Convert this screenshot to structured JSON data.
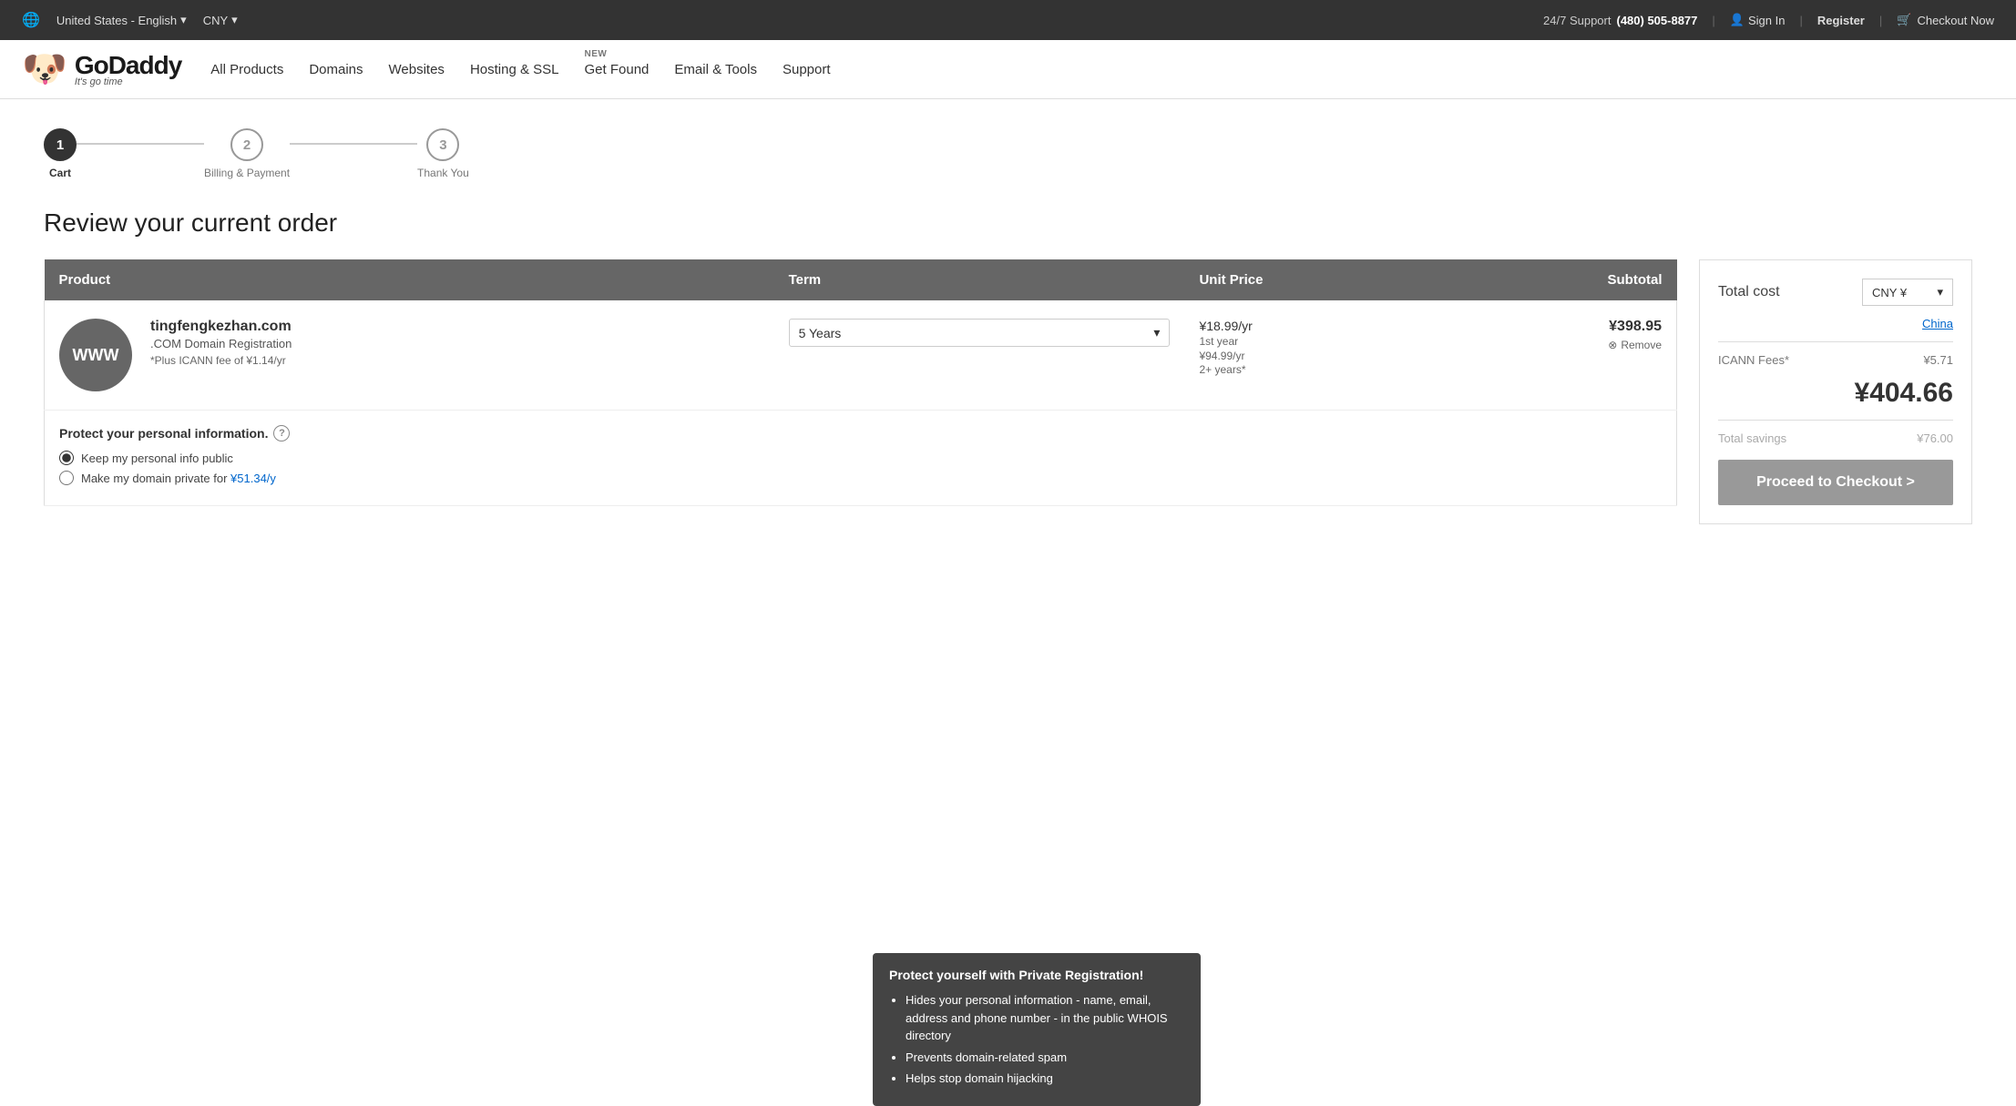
{
  "topbar": {
    "locale_label": "United States - English",
    "locale_arrow": "▾",
    "currency_label": "CNY",
    "currency_arrow": "▾",
    "support_label": "24/7 Support",
    "phone": "(480) 505-8877",
    "sign_in": "Sign In",
    "register": "Register",
    "checkout_now": "Checkout Now",
    "globe_icon": "🌐",
    "user_icon": "👤",
    "cart_icon": "🛒"
  },
  "nav": {
    "all_products": "All Products",
    "domains": "Domains",
    "websites": "Websites",
    "hosting_ssl": "Hosting & SSL",
    "get_found": "Get Found",
    "get_found_badge": "NEW",
    "email_tools": "Email & Tools",
    "support": "Support",
    "logo_main": "GoDaddy",
    "logo_sub": "It's go time"
  },
  "steps": [
    {
      "number": "1",
      "label": "Cart",
      "active": true
    },
    {
      "number": "2",
      "label": "Billing & Payment",
      "active": false
    },
    {
      "number": "3",
      "label": "Thank You",
      "active": false
    }
  ],
  "page": {
    "title": "Review your current order"
  },
  "cart": {
    "header": {
      "product": "Product",
      "term": "Term",
      "unit_price": "Unit Price",
      "subtotal": "Subtotal"
    },
    "product": {
      "name": "tingfengkezhan.com",
      "type": ".COM Domain Registration",
      "note": "*Plus ICANN fee of ¥1.14/yr",
      "www_label": "WWW",
      "term_value": "5 Years",
      "term_arrow": "▾",
      "price_main": "¥18.99/yr",
      "price_label1": "1st year",
      "price_label2": "¥94.99/yr",
      "price_label3": "2+ years*",
      "subtotal": "¥398.95",
      "remove_icon": "⊗",
      "remove_label": "Remove"
    },
    "protect": {
      "title": "Protect your personal information.",
      "info_icon": "?",
      "option1": "Keep my personal info public",
      "option2_prefix": "Make my domain private for",
      "option2_price": "¥51.34/y",
      "option1_checked": true,
      "option2_checked": false
    },
    "tooltip": {
      "title": "Protect yourself with Private Registration!",
      "bullets": [
        "Hides your personal information - name, email, address and phone number - in the public WHOIS directory",
        "Prevents domain-related spam",
        "Helps stop domain hijacking"
      ]
    }
  },
  "summary": {
    "title": "Total cost",
    "currency_label": "CNY ¥",
    "currency_arrow": "▾",
    "china_link": "China",
    "icann_label": "ICANN Fees*",
    "icann_value": "¥5.71",
    "total": "¥404.66",
    "savings_label": "Total savings",
    "savings_value": "¥76.00",
    "checkout_btn": "Proceed to Checkout >"
  }
}
